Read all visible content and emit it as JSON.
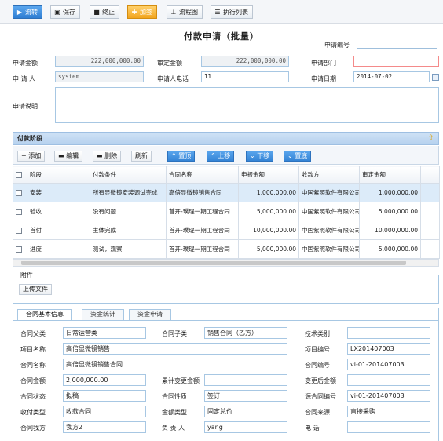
{
  "toolbar": {
    "buttons": [
      {
        "label": "流转",
        "icon": "flow-icon"
      },
      {
        "label": "保存",
        "icon": "save-icon"
      },
      {
        "label": "终止",
        "icon": "stop-icon"
      },
      {
        "label": "加签",
        "icon": "add-sign-icon"
      },
      {
        "label": "流程图",
        "icon": "flowchart-icon"
      },
      {
        "label": "执行列表",
        "icon": "list-icon"
      }
    ]
  },
  "form": {
    "title": "付款申请（批量）",
    "apply_no_label": "申请编号",
    "apply_no": "",
    "apply_amount_label": "申请金额",
    "apply_amount": "222,000,000.00",
    "approved_amount_label": "审定金额",
    "approved_amount": "222,000,000.00",
    "apply_dept_label": "申请部门",
    "apply_dept": "",
    "applicant_label": "申 请 人",
    "applicant": "system",
    "applicant_phone_label": "申请人电话",
    "applicant_phone": "11",
    "apply_date_label": "申请日期",
    "apply_date": "2014-07-02",
    "remark_label": "申请说明",
    "remark": ""
  },
  "stages": {
    "header": "付款阶段",
    "buttons": {
      "add": "添加",
      "edit": "编辑",
      "delete": "删除",
      "refresh": "刷新",
      "top": "置顶",
      "up": "上移",
      "down": "下移",
      "bottom": "置底"
    },
    "columns": [
      "阶段",
      "付款条件",
      "合同名称",
      "申报金额",
      "收款方",
      "审定金额"
    ],
    "rows": [
      [
        "安装",
        "所有显微镜安装调试完成",
        "高倍显微镜销售合同",
        "1,000,000.00",
        "中国紫照软件有限公司",
        "1,000,000.00"
      ],
      [
        "验收",
        "没有问题",
        "首开-璞瑅一期工程合同",
        "5,000,000.00",
        "中国紫照软件有限公司",
        "5,000,000.00"
      ],
      [
        "首付",
        "主体完成",
        "首开-璞瑅一期工程合同",
        "10,000,000.00",
        "中国紫照软件有限公司",
        "10,000,000.00"
      ],
      [
        "进度",
        "测试，观察",
        "首开-璞瑅一期工程合同",
        "5,000,000.00",
        "中国紫照软件有限公司",
        "5,000,000.00"
      ]
    ]
  },
  "attachment": {
    "legend": "附件",
    "upload": "上传文件"
  },
  "tabs": [
    "合同基本信息",
    "资金统计",
    "资金申请"
  ],
  "contract": {
    "parent_type_label": "合同父类",
    "parent_type": "日常运营类",
    "sub_type_label": "合同子类",
    "sub_type": "销售合同（乙方）",
    "tech_type_label": "技术类别",
    "tech_type": "",
    "project_name_label": "项目名称",
    "project_name": "高倍显微镜销售",
    "project_no_label": "项目编号",
    "project_no": "LX201407003",
    "contract_name_label": "合同名称",
    "contract_name": "高倍显微镜销售合同",
    "contract_no_label": "合同编号",
    "contract_no": "vi-01-201407003",
    "amount_label": "合同金额",
    "amount": "2,000,000.00",
    "acc_change_label": "累计变更金额",
    "acc_change": "",
    "after_change_label": "变更后金额",
    "after_change": "",
    "status_label": "合同状态",
    "status": "拟稿",
    "nature_label": "合同性质",
    "nature": "签订",
    "source_no_label": "源合同编号",
    "source_no": "vi-01-201407003",
    "pay_type_label": "收付类型",
    "pay_type": "收款合同",
    "amount_type_label": "金额类型",
    "amount_type": "固定总价",
    "source_label": "合同来源",
    "source": "直接采购",
    "our_party_label": "合同我方",
    "our_party": "我方2",
    "owner_label": "负 责 人",
    "owner": "yang",
    "phone_label": "电 话",
    "phone": ""
  }
}
